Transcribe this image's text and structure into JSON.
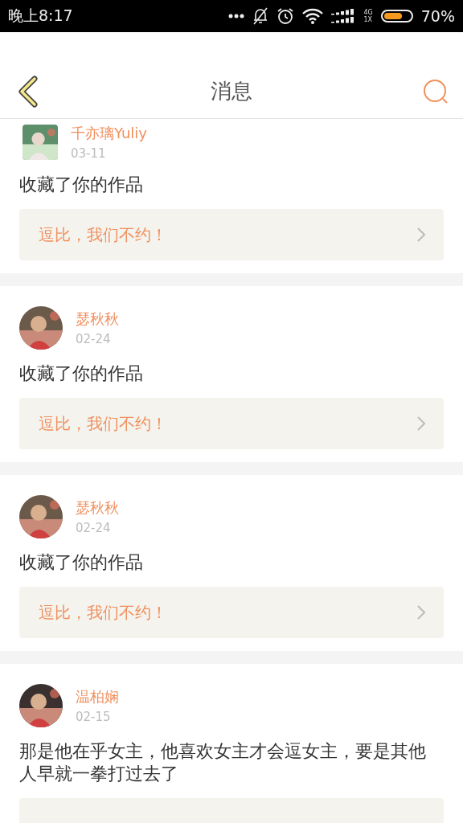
{
  "status_bar": {
    "time": "晚上8:17",
    "network_top": "4G",
    "network_bottom": "1X",
    "battery": {
      "level": 0.7
    },
    "battery_text": "70%"
  },
  "header": {
    "title": "消息"
  },
  "messages": [
    {
      "name": "千亦璃Yuliy",
      "date": "03-11",
      "kind": "square",
      "text": "收藏了你的作品",
      "quote": "逗比，我们不约！"
    },
    {
      "name": "瑟秋秋",
      "date": "02-24",
      "kind": "round",
      "text": "收藏了你的作品",
      "quote": "逗比，我们不约！"
    },
    {
      "name": "瑟秋秋",
      "date": "02-24",
      "kind": "round",
      "text": "收藏了你的作品",
      "quote": "逗比，我们不约！"
    },
    {
      "name": "温柏娴",
      "date": "02-15",
      "kind": "round",
      "text": "那是他在乎女主，他喜欢女主才会逗女主，要是其他人早就一拳打过去了",
      "quote_cut": true
    }
  ]
}
